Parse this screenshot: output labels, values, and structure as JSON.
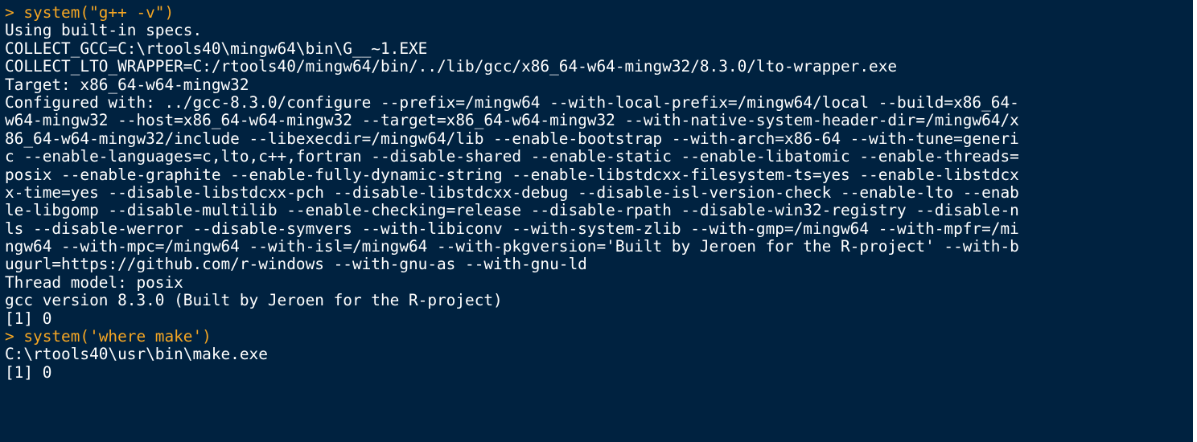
{
  "console": {
    "lines": [
      {
        "kind": "command",
        "text": "> system(\"g++ -v\")"
      },
      {
        "kind": "output",
        "text": "Using built-in specs."
      },
      {
        "kind": "output",
        "text": "COLLECT_GCC=C:\\rtools40\\mingw64\\bin\\G__~1.EXE"
      },
      {
        "kind": "output",
        "text": "COLLECT_LTO_WRAPPER=C:/rtools40/mingw64/bin/../lib/gcc/x86_64-w64-mingw32/8.3.0/lto-wrapper.exe"
      },
      {
        "kind": "output",
        "text": "Target: x86_64-w64-mingw32"
      },
      {
        "kind": "output",
        "text": "Configured with: ../gcc-8.3.0/configure --prefix=/mingw64 --with-local-prefix=/mingw64/local --build=x86_64-"
      },
      {
        "kind": "output",
        "text": "w64-mingw32 --host=x86_64-w64-mingw32 --target=x86_64-w64-mingw32 --with-native-system-header-dir=/mingw64/x"
      },
      {
        "kind": "output",
        "text": "86_64-w64-mingw32/include --libexecdir=/mingw64/lib --enable-bootstrap --with-arch=x86-64 --with-tune=generi"
      },
      {
        "kind": "output",
        "text": "c --enable-languages=c,lto,c++,fortran --disable-shared --enable-static --enable-libatomic --enable-threads="
      },
      {
        "kind": "output",
        "text": "posix --enable-graphite --enable-fully-dynamic-string --enable-libstdcxx-filesystem-ts=yes --enable-libstdcx"
      },
      {
        "kind": "output",
        "text": "x-time=yes --disable-libstdcxx-pch --disable-libstdcxx-debug --disable-isl-version-check --enable-lto --enab"
      },
      {
        "kind": "output",
        "text": "le-libgomp --disable-multilib --enable-checking=release --disable-rpath --disable-win32-registry --disable-n"
      },
      {
        "kind": "output",
        "text": "ls --disable-werror --disable-symvers --with-libiconv --with-system-zlib --with-gmp=/mingw64 --with-mpfr=/mi"
      },
      {
        "kind": "output",
        "text": "ngw64 --with-mpc=/mingw64 --with-isl=/mingw64 --with-pkgversion='Built by Jeroen for the R-project' --with-b"
      },
      {
        "kind": "output",
        "text": "ugurl=https://github.com/r-windows --with-gnu-as --with-gnu-ld"
      },
      {
        "kind": "output",
        "text": "Thread model: posix"
      },
      {
        "kind": "output",
        "text": "gcc version 8.3.0 (Built by Jeroen for the R-project)"
      },
      {
        "kind": "output",
        "text": "[1] 0"
      },
      {
        "kind": "command",
        "text": "> system('where make')"
      },
      {
        "kind": "output",
        "text": "C:\\rtools40\\usr\\bin\\make.exe"
      },
      {
        "kind": "output",
        "text": "[1] 0"
      }
    ]
  },
  "colors": {
    "background": "#002240",
    "command": "#f5a623",
    "output": "#ffffff"
  }
}
